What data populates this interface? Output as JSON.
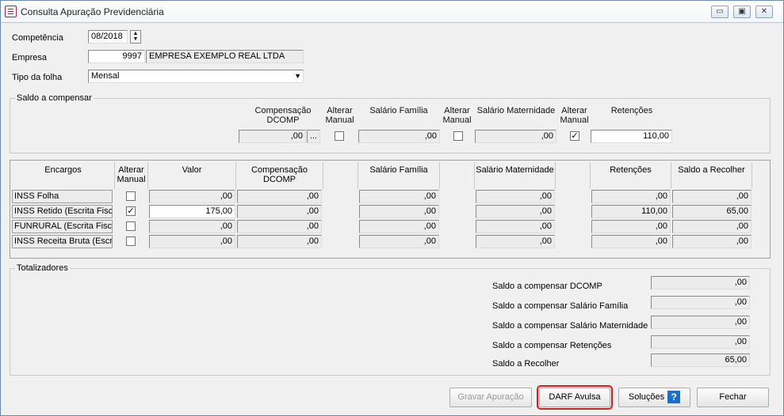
{
  "window": {
    "title": "Consulta Apuração Previdenciária",
    "controls": [
      "▭",
      "▣",
      "✕"
    ]
  },
  "header": {
    "competencia_label": "Competência",
    "competencia_value": "08/2018",
    "empresa_label": "Empresa",
    "empresa_code": "9997",
    "empresa_name": "EMPRESA EXEMPLO REAL LTDA",
    "tipo_label": "Tipo da folha",
    "tipo_value": "Mensal"
  },
  "saldo": {
    "title": "Saldo a compensar",
    "h_comp": "Compensação\nDCOMP",
    "h_alt1": "Alterar\nManual",
    "h_sal_fam": "Salário Família",
    "h_alt2": "Alterar\nManual",
    "h_sal_mat": "Salário Maternidade",
    "h_alt3": "Alterar\nManual",
    "h_ret": "Retenções",
    "comp_value": ",00",
    "ellipsis": "...",
    "sal_fam_value": ",00",
    "sal_mat_value": ",00",
    "ret_value": "110,00",
    "alt1_checked": false,
    "alt2_checked": false,
    "alt3_checked": true
  },
  "grid": {
    "headers": {
      "encargos": "Encargos",
      "alterar": "Alterar\nManual",
      "valor": "Valor",
      "comp": "Compensação\nDCOMP",
      "sal_fam": "Salário Família",
      "sal_mat": "Salário Maternidade",
      "ret": "Retenções",
      "saldo": "Saldo a Recolher"
    },
    "rows": [
      {
        "label": "INSS Folha",
        "checked": false,
        "valor": ",00",
        "comp": ",00",
        "sal_fam": ",00",
        "sal_mat": ",00",
        "ret": ",00",
        "saldo": ",00"
      },
      {
        "label": "INSS Retido (Escrita Fiscal)",
        "checked": true,
        "valor": "175,00",
        "comp": ",00",
        "sal_fam": ",00",
        "sal_mat": ",00",
        "ret": "110,00",
        "saldo": "65,00"
      },
      {
        "label": "FUNRURAL (Escrita Fiscal)",
        "checked": false,
        "valor": ",00",
        "comp": ",00",
        "sal_fam": ",00",
        "sal_mat": ",00",
        "ret": ",00",
        "saldo": ",00"
      },
      {
        "label": "INSS Receita Bruta (Escrita Fiscal)",
        "checked": false,
        "valor": ",00",
        "comp": ",00",
        "sal_fam": ",00",
        "sal_mat": ",00",
        "ret": ",00",
        "saldo": ",00"
      }
    ]
  },
  "totalizadores": {
    "title": "Totalizadores",
    "items": [
      {
        "label": "Saldo a compensar DCOMP",
        "value": ",00"
      },
      {
        "label": "Saldo a compensar Salário Família",
        "value": ",00"
      },
      {
        "label": "Saldo a compensar Salário Maternidade",
        "value": ",00"
      },
      {
        "label": "Saldo a compensar Retenções",
        "value": ",00"
      },
      {
        "label": "Saldo a Recolher",
        "value": "65,00"
      }
    ]
  },
  "buttons": {
    "gravar": "Gravar Apuração",
    "darf": "DARF Avulsa",
    "solucoes": "Soluções",
    "help_glyph": "?",
    "fechar": "Fechar"
  },
  "colors": {
    "highlight": "#d62020",
    "title_icon": "#a2234c"
  }
}
